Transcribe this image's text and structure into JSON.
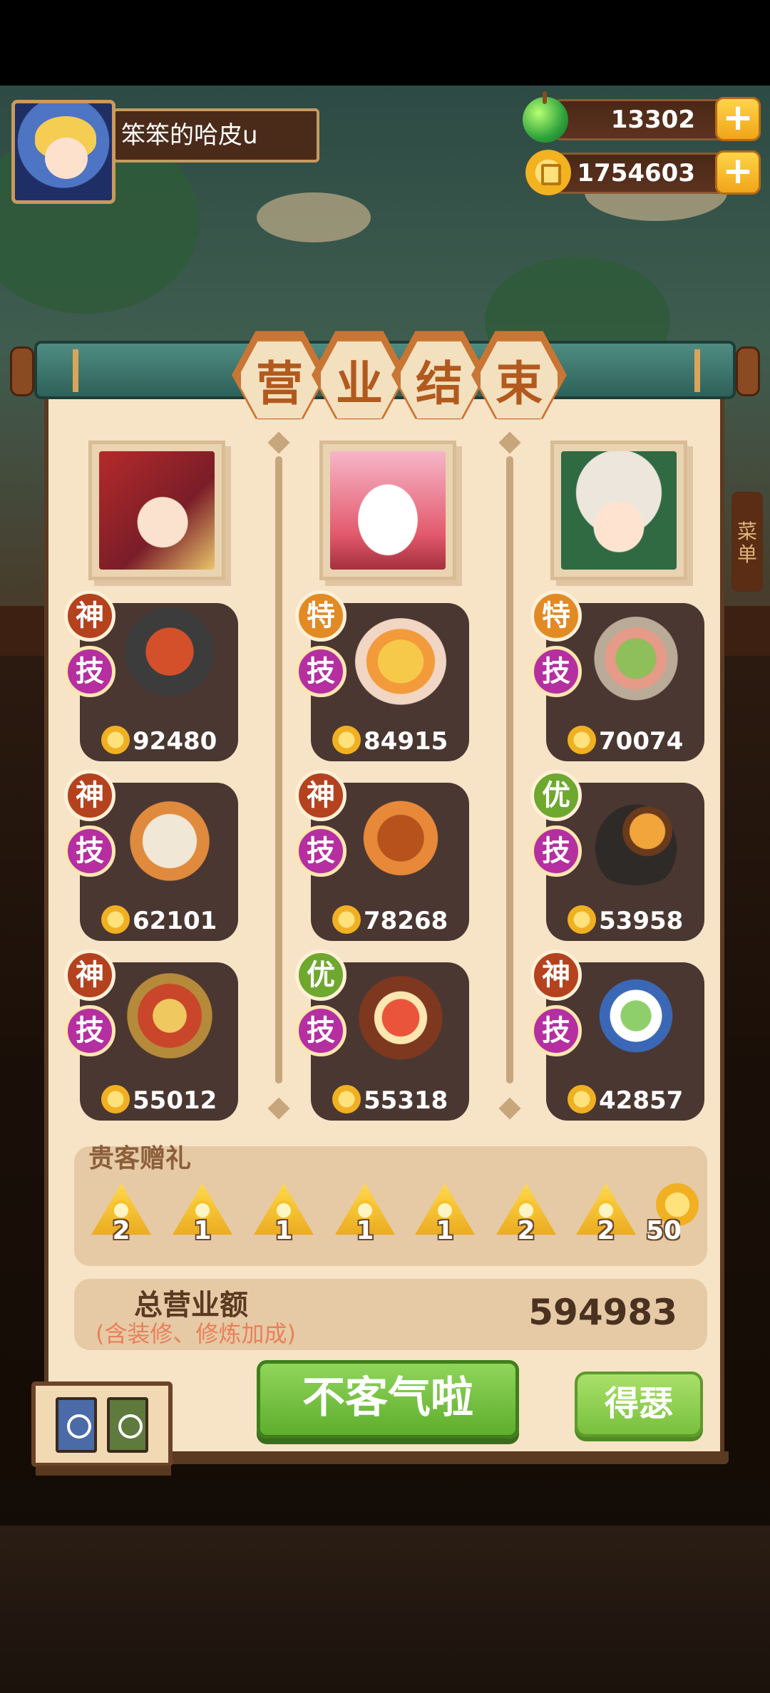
{
  "player": {
    "name": "笨笨的哈皮u",
    "avatar": "blonde-character-avatar"
  },
  "resources": {
    "gems": {
      "icon": "green-gem-icon",
      "value": "13302",
      "plus": "+"
    },
    "coins": {
      "icon": "coin-icon",
      "value": "1754603",
      "plus": "+"
    }
  },
  "title": [
    "营",
    "业",
    "结",
    "束"
  ],
  "columns": [
    {
      "portrait": "red-hair-girl-portrait",
      "dishes": [
        {
          "grade": "神",
          "skill": "技",
          "icon": "roast-duck-dish-icon",
          "score": "92480"
        },
        {
          "grade": "神",
          "skill": "技",
          "icon": "cat-bowl-dish-icon",
          "score": "62101"
        },
        {
          "grade": "神",
          "skill": "技",
          "icon": "hotpot-dish-icon",
          "score": "55012"
        }
      ]
    },
    {
      "portrait": "hello-kitty-portrait",
      "dishes": [
        {
          "grade": "特",
          "skill": "技",
          "icon": "omelette-plate-dish-icon",
          "score": "84915"
        },
        {
          "grade": "神",
          "skill": "技",
          "icon": "soup-urn-dish-icon",
          "score": "78268"
        },
        {
          "grade": "优",
          "skill": "技",
          "icon": "bento-box-dish-icon",
          "score": "55318"
        }
      ]
    },
    {
      "portrait": "white-hair-boy-portrait",
      "dishes": [
        {
          "grade": "特",
          "skill": "技",
          "icon": "drumstick-salad-dish-icon",
          "score": "70074"
        },
        {
          "grade": "优",
          "skill": "技",
          "icon": "burger-platter-dish-icon",
          "score": "53958"
        },
        {
          "grade": "神",
          "skill": "技",
          "icon": "porcelain-bowl-dish-icon",
          "score": "42857"
        }
      ]
    }
  ],
  "gifts": {
    "title": "贵客赠礼",
    "items": [
      {
        "icon": "gift-token-icon",
        "count": "2"
      },
      {
        "icon": "gift-token-icon",
        "count": "1"
      },
      {
        "icon": "gift-token-icon",
        "count": "1"
      },
      {
        "icon": "gift-token-icon",
        "count": "1"
      },
      {
        "icon": "gift-token-icon",
        "count": "1"
      },
      {
        "icon": "gift-token-icon",
        "count": "2"
      },
      {
        "icon": "gift-token-icon",
        "count": "2"
      }
    ],
    "coin_count": "50"
  },
  "total": {
    "label": "总营业额",
    "sub": "(含装修、修炼加成)",
    "value": "594983"
  },
  "buttons": {
    "main": "不客气啦",
    "secondary": "得瑟"
  },
  "side_tag": "菜单",
  "colors": {
    "grade_shen": "#b4421f",
    "grade_te": "#e28a24",
    "grade_you": "#6ea82e",
    "skill": "#b52fa1",
    "panel": "#f7e3c6",
    "card": "#4a3731",
    "button_green": "#6cbd38"
  }
}
